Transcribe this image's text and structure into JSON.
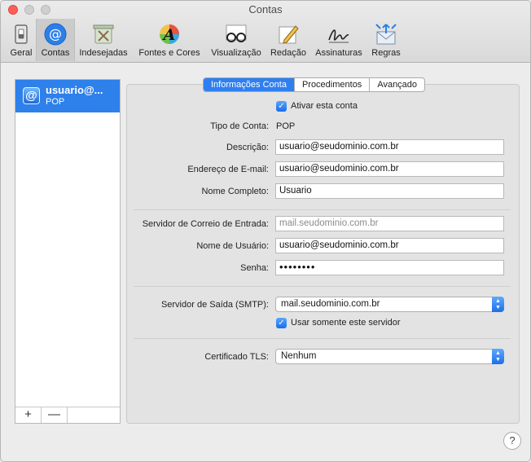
{
  "window": {
    "title": "Contas"
  },
  "toolbar": {
    "items": [
      {
        "label": "Geral",
        "icon": "general-switch-icon"
      },
      {
        "label": "Contas",
        "icon": "at-sign-icon"
      },
      {
        "label": "Indesejadas",
        "icon": "junk-trash-icon"
      },
      {
        "label": "Fontes e Cores",
        "icon": "fonts-colors-icon"
      },
      {
        "label": "Visualização",
        "icon": "glasses-icon"
      },
      {
        "label": "Redação",
        "icon": "pencil-paper-icon"
      },
      {
        "label": "Assinaturas",
        "icon": "signature-icon"
      },
      {
        "label": "Regras",
        "icon": "rules-envelope-icon"
      }
    ]
  },
  "sidebar": {
    "account": {
      "name": "usuario@...",
      "type": "POP"
    },
    "add_label": "+",
    "remove_label": "—"
  },
  "tabs": [
    {
      "label": "Informações Conta",
      "selected": true
    },
    {
      "label": "Procedimentos",
      "selected": false
    },
    {
      "label": "Avançado",
      "selected": false
    }
  ],
  "form": {
    "enable_account": {
      "label": "Ativar esta conta",
      "checked": true
    },
    "account_type": {
      "label": "Tipo de Conta:",
      "value": "POP"
    },
    "description": {
      "label": "Descrição:",
      "value": "usuario@seudominio.com.br"
    },
    "email": {
      "label": "Endereço de E-mail:",
      "value": "usuario@seudominio.com.br"
    },
    "full_name": {
      "label": "Nome Completo:",
      "value": "Usuario"
    },
    "incoming_server": {
      "label": "Servidor de Correio de Entrada:",
      "placeholder": "mail.seudominio.com.br"
    },
    "username": {
      "label": "Nome de Usuário:",
      "value": "usuario@seudominio.com.br"
    },
    "password": {
      "label": "Senha:",
      "value": "••••••••"
    },
    "smtp": {
      "label": "Servidor de Saída (SMTP):",
      "value": "mail.seudominio.com.br"
    },
    "only_this_server": {
      "label": "Usar somente este servidor",
      "checked": true
    },
    "tls": {
      "label": "Certificado TLS:",
      "value": "Nenhum"
    }
  },
  "help_label": "?",
  "colors": {
    "accent": "#2f7ff0",
    "close": "#fc5f57"
  }
}
